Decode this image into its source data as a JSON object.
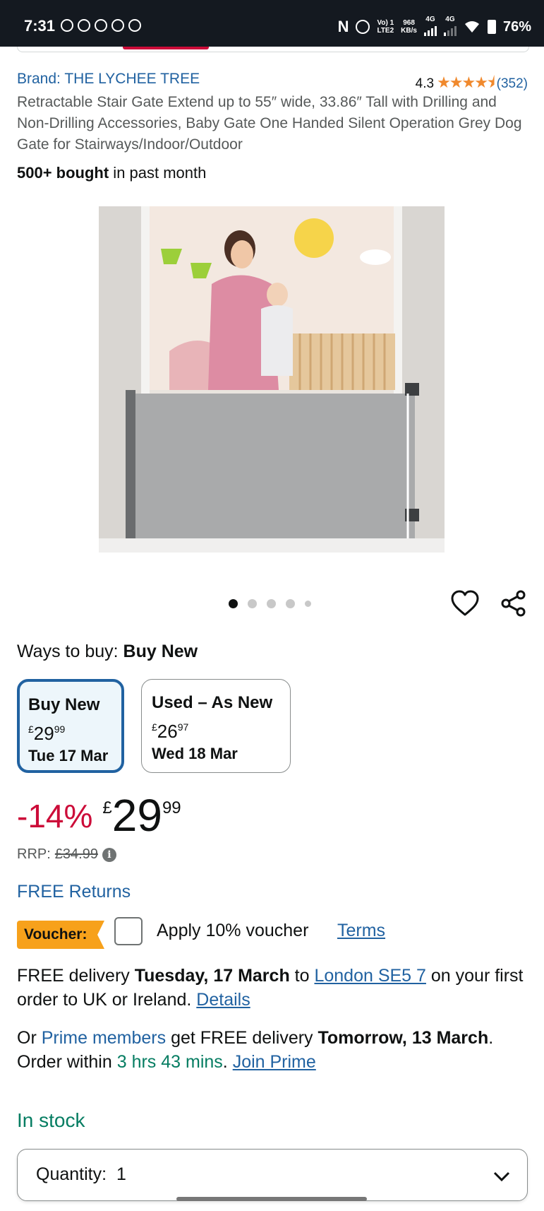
{
  "status_bar": {
    "time": "7:31",
    "network_top": "Vo) 1",
    "network_bottom": "LTE2",
    "speed_top": "968",
    "speed_bottom": "KB/s",
    "sig1": "4G",
    "sig2": "4G",
    "battery": "76%"
  },
  "product": {
    "brand": "Brand: THE LYCHEE TREE",
    "rating": "4.3",
    "stars": "★★★★⯨",
    "rating_count": "(352)",
    "title": "Retractable Stair Gate Extend up to 55″ wide, 33.86″ Tall with Drilling and Non-Drilling Accessories, Baby Gate One Handed Silent Operation Grey Dog Gate for Stairways/Indoor/Outdoor",
    "bought_bold": "500+ bought",
    "bought_rest": " in past month",
    "image_count": 5,
    "active_image": 1
  },
  "ways_to_buy": {
    "label": "Ways to buy: ",
    "selected": "Buy New",
    "options": [
      {
        "label": "Buy New",
        "currency": "£",
        "whole": "29",
        "fraction": "99",
        "date": "Tue 17 Mar"
      },
      {
        "label": "Used – As New",
        "currency": "£",
        "whole": "26",
        "fraction": "97",
        "date": "Wed 18 Mar"
      }
    ]
  },
  "price": {
    "discount": "-14%",
    "currency": "£",
    "whole": "29",
    "fraction": "99",
    "rrp_label": "RRP: ",
    "rrp_value": "£34.99",
    "info_icon": "i"
  },
  "returns": "FREE Returns",
  "voucher": {
    "tag": "Voucher:",
    "text": "Apply 10% voucher",
    "terms": "Terms"
  },
  "delivery": {
    "p1": "FREE delivery ",
    "date": "Tuesday, 17 March",
    "p2": " to ",
    "location": "London SE5 7",
    "p3": " on your first order to UK or Ireland. ",
    "details": "Details"
  },
  "prime": {
    "p1": "Or ",
    "members": "Prime members",
    "p2": " get FREE delivery ",
    "date": "Tomorrow, 13 March",
    "p3": ". Order within ",
    "countdown": "3 hrs 43 mins",
    "p4": ". ",
    "join": "Join Prime"
  },
  "stock": "In stock",
  "quantity": {
    "label": "Quantity:",
    "value": "1"
  }
}
